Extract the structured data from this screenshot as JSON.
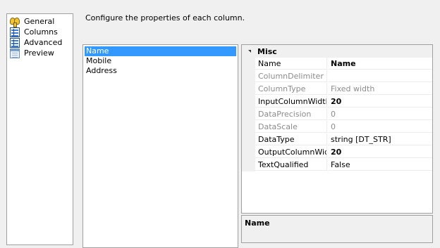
{
  "nav": {
    "items": [
      {
        "label": "General",
        "icon": "general-icon"
      },
      {
        "label": "Columns",
        "icon": "columns-grid-icon"
      },
      {
        "label": "Advanced",
        "icon": "advanced-grid-icon"
      },
      {
        "label": "Preview",
        "icon": "preview-icon"
      }
    ]
  },
  "description": "Configure the properties of each column.",
  "columns": {
    "items": [
      "Name",
      "Mobile",
      "Address"
    ],
    "selected": "Name"
  },
  "properties": {
    "category": "Misc",
    "rows": [
      {
        "name": "Name",
        "value": "Name"
      },
      {
        "name": "ColumnDelimiter",
        "value": ""
      },
      {
        "name": "ColumnType",
        "value": "Fixed width"
      },
      {
        "name": "InputColumnWidth",
        "value": "20"
      },
      {
        "name": "DataPrecision",
        "value": "0"
      },
      {
        "name": "DataScale",
        "value": "0"
      },
      {
        "name": "DataType",
        "value": "string [DT_STR]"
      },
      {
        "name": "OutputColumnWidth",
        "value": "20"
      },
      {
        "name": "TextQualified",
        "value": "False"
      }
    ]
  },
  "help": {
    "title": "Name"
  },
  "colors": {
    "selection": "#3399ff",
    "disabled_text": "#8c8c8c"
  }
}
